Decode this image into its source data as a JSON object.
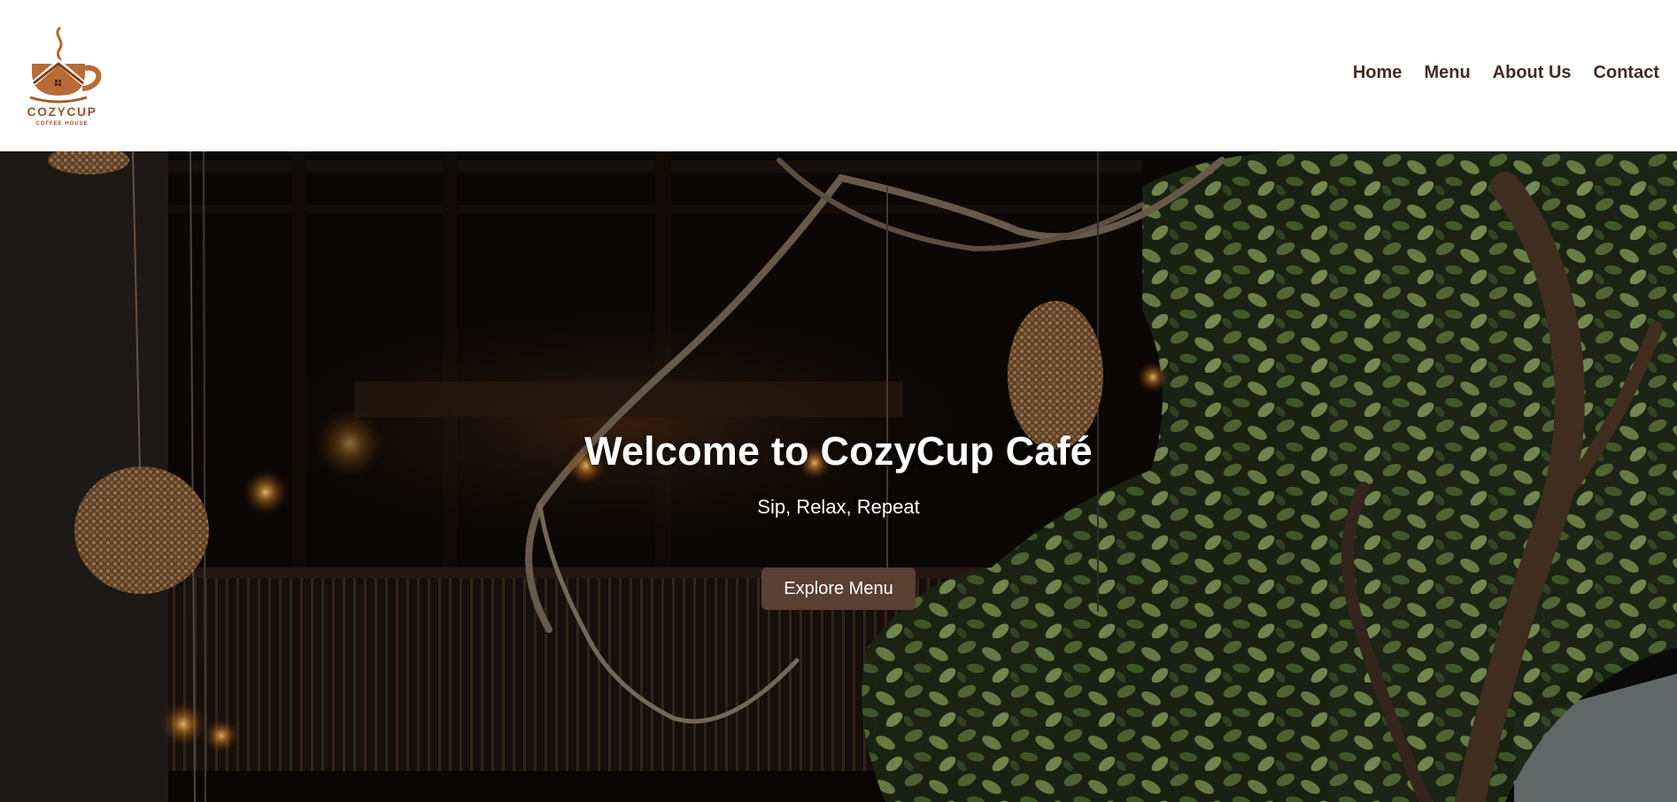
{
  "brand": {
    "name": "COZYCUP",
    "tagline": "COFFEE HOUSE",
    "logo_icon": "coffee-cup-house-icon",
    "color": "#a0522d"
  },
  "nav": {
    "items": [
      {
        "label": "Home"
      },
      {
        "label": "Menu"
      },
      {
        "label": "About Us"
      },
      {
        "label": "Contact"
      }
    ],
    "color": "#3f2d24"
  },
  "hero": {
    "title": "Welcome to CozyCup Café",
    "subtitle": "Sip, Relax, Repeat",
    "button_label": "Explore Menu",
    "button_color": "#5a3f33",
    "background_image": "dark café interior with hanging woven lamps, bare branches and green tree foliage"
  }
}
